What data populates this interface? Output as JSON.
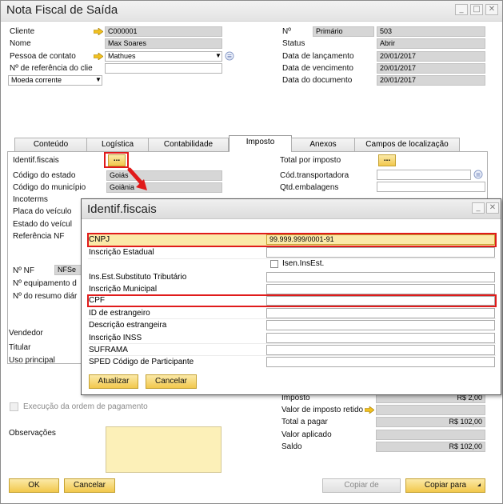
{
  "window": {
    "title": "Nota Fiscal de Saída",
    "min": "_",
    "max": "□",
    "close": "✕"
  },
  "header_left": [
    {
      "label": "Cliente",
      "value": "C000001",
      "arrow": true
    },
    {
      "label": "Nome",
      "value": "Max Soares"
    },
    {
      "label": "Pessoa de contato",
      "value": "Mathues",
      "arrow": true
    },
    {
      "label": "Nº de referência do clie",
      "value": ""
    }
  ],
  "currency": {
    "value": "Moeda corrente"
  },
  "header_right": {
    "numero_label": "Nº",
    "serie": "Primário",
    "numero": "503",
    "rows": [
      {
        "label": "Status",
        "value": "Abrir"
      },
      {
        "label": "Data de lançamento",
        "value": "20/01/2017"
      },
      {
        "label": "Data de vencimento",
        "value": "20/01/2017"
      },
      {
        "label": "Data do documento",
        "value": "20/01/2017"
      }
    ]
  },
  "tabs": [
    "Conteúdo",
    "Logística",
    "Contabilidade",
    "Imposto",
    "Anexos",
    "Campos de localização"
  ],
  "tax_left": {
    "identif": "Identif.fiscais",
    "dots": "...",
    "rows": [
      {
        "label": "Código do estado",
        "value": "Goiás"
      },
      {
        "label": "Código do município",
        "value": "Goiânia"
      },
      {
        "label": "Incoterms",
        "value": ""
      },
      {
        "label": "Placa do veículo",
        "value": ""
      },
      {
        "label": "Estado do veícul",
        "value": ""
      },
      {
        "label": "Referência NF",
        "value": ""
      }
    ],
    "nf_label": "Nº NF",
    "nf_value": "NFSe",
    "equip_label": "Nº equipamento d",
    "resumo_label": "Nº do resumo diár"
  },
  "tax_right": {
    "total_label": "Total por imposto",
    "dots": "...",
    "transp_label": "Cód.transportadora",
    "emb_label": "Qtd.embalagens"
  },
  "lower_left": [
    "Vendedor",
    "Titular",
    "Uso principal"
  ],
  "payment_check": "Execução da ordem de pagamento",
  "obs_label": "Observações",
  "totals": [
    {
      "label": "Imposto",
      "value": "R$ 2,00"
    },
    {
      "label": "Valor de imposto retido",
      "value": ""
    },
    {
      "label": "Total a pagar",
      "value": "R$ 102,00"
    },
    {
      "label": "Valor aplicado",
      "value": ""
    },
    {
      "label": "Saldo",
      "value": "R$ 102,00"
    }
  ],
  "footer": {
    "ok": "OK",
    "cancel": "Cancelar",
    "copy_from": "Copiar de",
    "copy_to": "Copiar para"
  },
  "dialog": {
    "title": "Identif.fiscais",
    "min": "_",
    "close": "✕",
    "fields": [
      {
        "label": "CNPJ",
        "value": "99.999.999/0001-91"
      },
      {
        "label": "Inscrição Estadual",
        "value": ""
      },
      {
        "label": "Ins.Est.Substituto Tributário",
        "value": ""
      },
      {
        "label": "Inscrição Municipal",
        "value": ""
      },
      {
        "label": "CPF",
        "value": ""
      },
      {
        "label": "ID de estrangeiro",
        "value": ""
      },
      {
        "label": "Descrição estrangeira",
        "value": ""
      },
      {
        "label": "Inscrição INSS",
        "value": ""
      },
      {
        "label": "SUFRAMA",
        "value": ""
      },
      {
        "label": "SPED Código de Participante",
        "value": ""
      }
    ],
    "isen": "Isen.InsEst.",
    "update": "Atualizar",
    "cancel": "Cancelar"
  },
  "colors": {
    "accent_yellow": "#f2c84c",
    "highlight": "#e01b1b",
    "readonly": "#d6d6d6"
  }
}
